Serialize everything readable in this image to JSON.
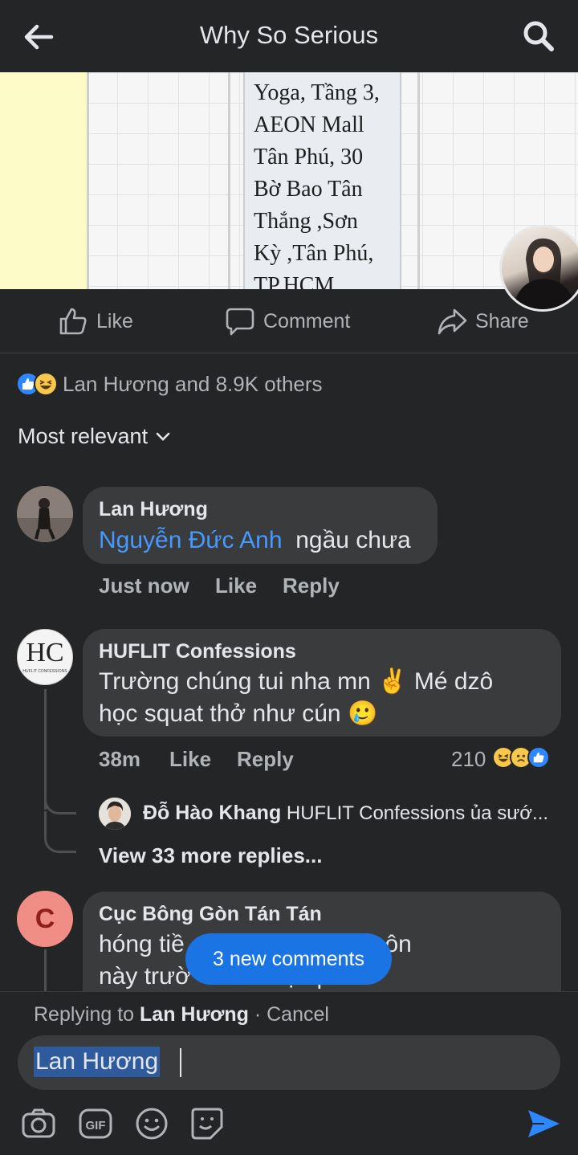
{
  "header": {
    "title": "Why So Serious"
  },
  "post_image": {
    "text": "Yoga, Tầng 3,\nAEON Mall\nTân Phú, 30\nBờ Bao Tân\nThắng ,Sơn\nKỳ ,Tân Phú,\nTP.HCM"
  },
  "actions": {
    "like": "Like",
    "comment": "Comment",
    "share": "Share"
  },
  "reactions": {
    "summary": "Lan Hương and 8.9K others",
    "icons": [
      "like-icon",
      "haha-icon"
    ]
  },
  "sort": {
    "label": "Most relevant"
  },
  "comments": [
    {
      "author": "Lan Hương",
      "mention": "Nguyễn Đức Anh",
      "text": "ngầu chưa",
      "time": "Just now",
      "like": "Like",
      "reply": "Reply"
    },
    {
      "author": "HUFLIT Confessions",
      "line1": "Trường chúng tui nha mn ✌️ Mé dzô",
      "line2": "học squat thở như cún 🥲",
      "time": "38m",
      "like": "Like",
      "reply": "Reply",
      "reaction_count": "210",
      "reaction_icons": [
        "haha-icon",
        "sad-icon",
        "like-icon"
      ],
      "avatar_text": "HC",
      "avatar_caption": "HUFLIT CONFESSIONS",
      "reply_preview": {
        "author": "Đỗ Hào Khang",
        "text": "HUFLIT Confessions ủa sướ..."
      },
      "view_more": "View 33 more replies..."
    },
    {
      "author": "Cục Bông Gòn Tán Tán",
      "avatar_letter": "C",
      "line1": "hóng tiề              ớc mấy môn",
      "line2": "này trườ              ọc phần"
    }
  ],
  "new_comments": "3 new comments",
  "composer": {
    "replying_prefix": "Replying to",
    "replying_name": "Lan Hương",
    "cancel": "· Cancel",
    "input_value": "Lan Hương"
  },
  "colors": {
    "background": "#242526",
    "bubble": "#3a3b3c",
    "accent": "#1b74e4",
    "mention": "#4599ff"
  }
}
